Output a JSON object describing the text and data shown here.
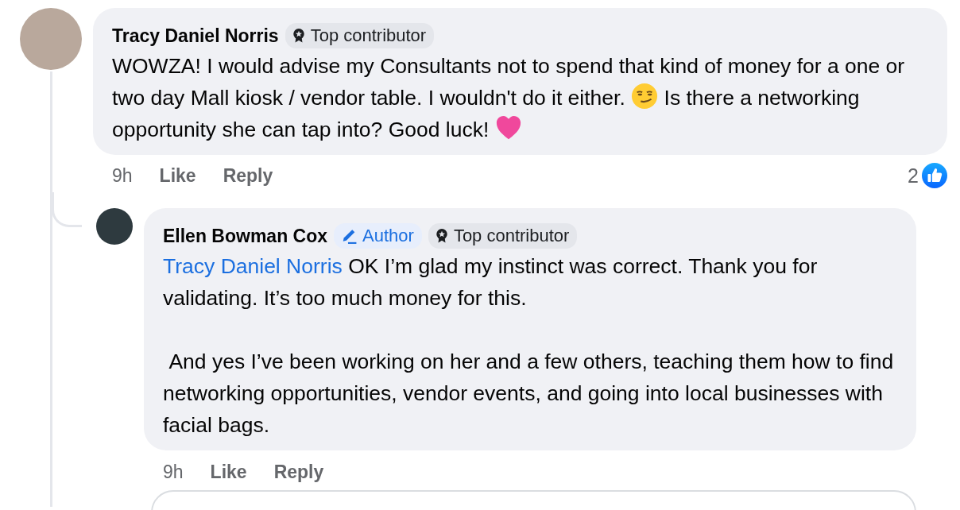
{
  "comments": [
    {
      "author": "Tracy Daniel Norris",
      "badges": [
        {
          "kind": "top",
          "label": "Top contributor"
        }
      ],
      "paragraphs": [
        {
          "segments": [
            {
              "kind": "text",
              "text": "WOWZA! I would advise my Consultants not to spend that kind of money for a one or two day Mall kiosk / vendor table. I wouldn't do it either. "
            },
            {
              "kind": "smirk"
            },
            {
              "kind": "text",
              "text": " Is there a networking opportunity she can tap into? Good luck! "
            },
            {
              "kind": "heart"
            }
          ]
        }
      ],
      "time": "9h",
      "actions": [
        "Like",
        "Reply"
      ],
      "reaction_count": "2",
      "replies": [
        {
          "author": "Ellen Bowman Cox",
          "badges": [
            {
              "kind": "author",
              "label": "Author"
            },
            {
              "kind": "top",
              "label": "Top contributor"
            }
          ],
          "paragraphs": [
            {
              "segments": [
                {
                  "kind": "mention",
                  "text": "Tracy Daniel Norris"
                },
                {
                  "kind": "text",
                  "text": " OK I’m glad my instinct was correct. Thank you for validating. It’s too much money for this."
                }
              ]
            },
            {
              "segments": [
                {
                  "kind": "text",
                  "text": " And yes I’ve been working on her and a few others, teaching them how to find networking opportunities, vendor events, and going into local businesses with facial bags."
                }
              ]
            }
          ],
          "time": "9h",
          "actions": [
            "Like",
            "Reply"
          ]
        }
      ]
    }
  ]
}
